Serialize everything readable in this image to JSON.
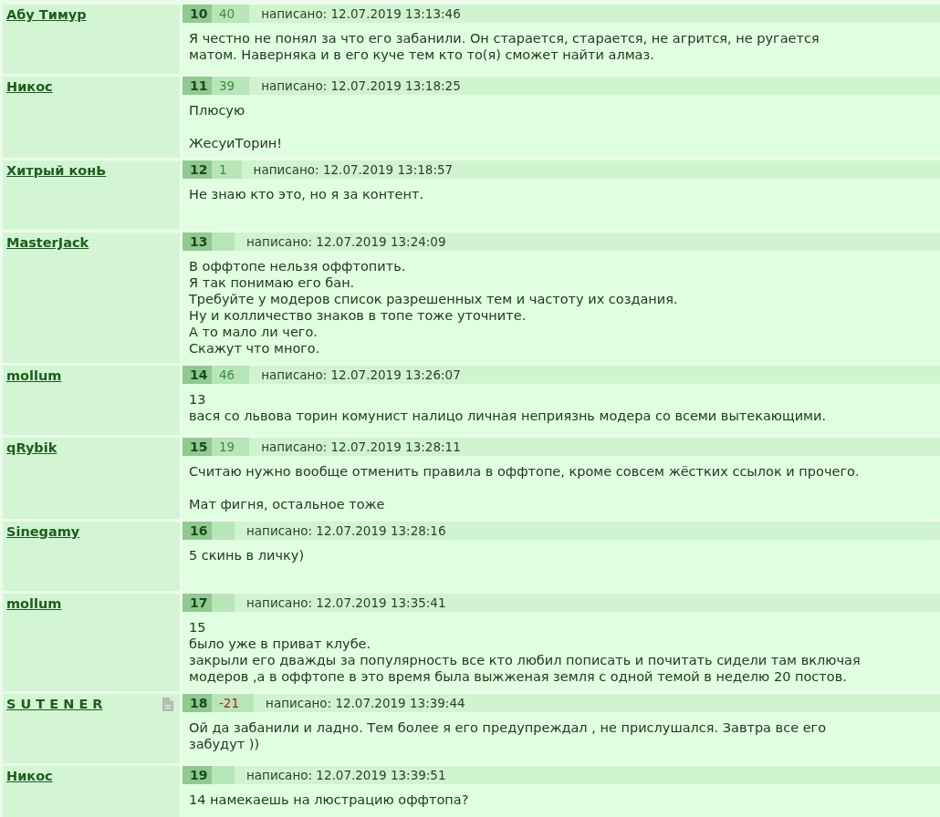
{
  "posts": [
    {
      "author": "Абу Тимур",
      "has_note": false,
      "number": "10",
      "rating": "40",
      "rating_negative": false,
      "posted": "написано: 12.07.2019 13:13:46",
      "text": "Я честно не понял за что его забанили. Он старается, старается, не агрится, не ругается матом. Наверняка и в его куче тем кто то(я) сможет найти алмаз."
    },
    {
      "author": "Никос",
      "has_note": false,
      "number": "11",
      "rating": "39",
      "rating_negative": false,
      "posted": "написано: 12.07.2019 13:18:25",
      "text": "Плюсую\n\nЖесуиТорин!"
    },
    {
      "author": "Хитрый конЬ",
      "has_note": false,
      "number": "12",
      "rating": "1",
      "rating_negative": false,
      "posted": "написано: 12.07.2019 13:18:57",
      "text": "Не знаю кто это, но я за контент."
    },
    {
      "author": "MasterJack",
      "has_note": false,
      "number": "13",
      "posted": "написано: 12.07.2019 13:24:09",
      "text": "В оффтопе нельзя оффтопить.\nЯ так понимаю его бан.\nТребуйте у модеров список разрешенных тем и частоту их создания.\nНу и колличество знаков в топе тоже уточните.\nА то мало ли чего.\nСкажут что много."
    },
    {
      "author": "mollum",
      "has_note": false,
      "number": "14",
      "rating": "46",
      "rating_negative": false,
      "posted": "написано: 12.07.2019 13:26:07",
      "text": "13\nвася со львова торин комунист налицо личная неприязнь модера со всеми вытекающими."
    },
    {
      "author": "qRybik",
      "has_note": false,
      "number": "15",
      "rating": "19",
      "rating_negative": false,
      "posted": "написано: 12.07.2019 13:28:11",
      "text": "Считаю нужно вообще отменить правила в оффтопе, кроме совсем жёстких ссылок и прочего.\n\nМат фигня, остальное тоже"
    },
    {
      "author": "Sinegamy",
      "has_note": false,
      "number": "16",
      "posted": "написано: 12.07.2019 13:28:16",
      "text": "5 скинь в личку)"
    },
    {
      "author": "mollum",
      "has_note": false,
      "number": "17",
      "posted": "написано: 12.07.2019 13:35:41",
      "text": "15\nбыло уже в приват клубе.\nзакрыли его дважды за популярность все кто любил пописать и почитать сидели там включая модеров ,а в оффтопе в это время была выжженая земля с одной темой в неделю 20 постов."
    },
    {
      "author": "S U T E N E R",
      "has_note": true,
      "number": "18",
      "rating": "-21",
      "rating_negative": true,
      "posted": "написано: 12.07.2019 13:39:44",
      "text": "Ой да забанили и ладно. Тем более я его предупреждал , не прислушался. Завтра все его забудут ))"
    },
    {
      "author": "Никос",
      "has_note": false,
      "number": "19",
      "posted": "написано: 12.07.2019 13:39:51",
      "text": "14 намекаешь на люстрацию оффтопа?"
    }
  ]
}
